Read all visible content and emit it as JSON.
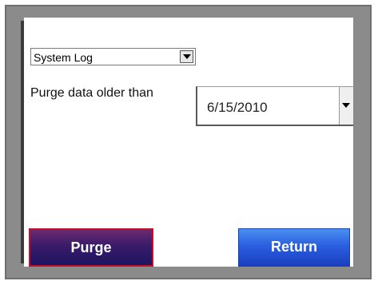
{
  "log_select": {
    "value": "System Log",
    "arrow_icon": "chevron-down-icon"
  },
  "purge_label": "Purge data older than",
  "date_select": {
    "value": "6/15/2010",
    "arrow_icon": "chevron-down-icon"
  },
  "buttons": {
    "purge_label": "Purge",
    "return_label": "Return"
  },
  "colors": {
    "purge_button_border": "#c0102a",
    "purge_button_fill": "#3a1a6a",
    "return_button_fill": "#2a5fe0",
    "bezel": "#8b8b8b"
  }
}
